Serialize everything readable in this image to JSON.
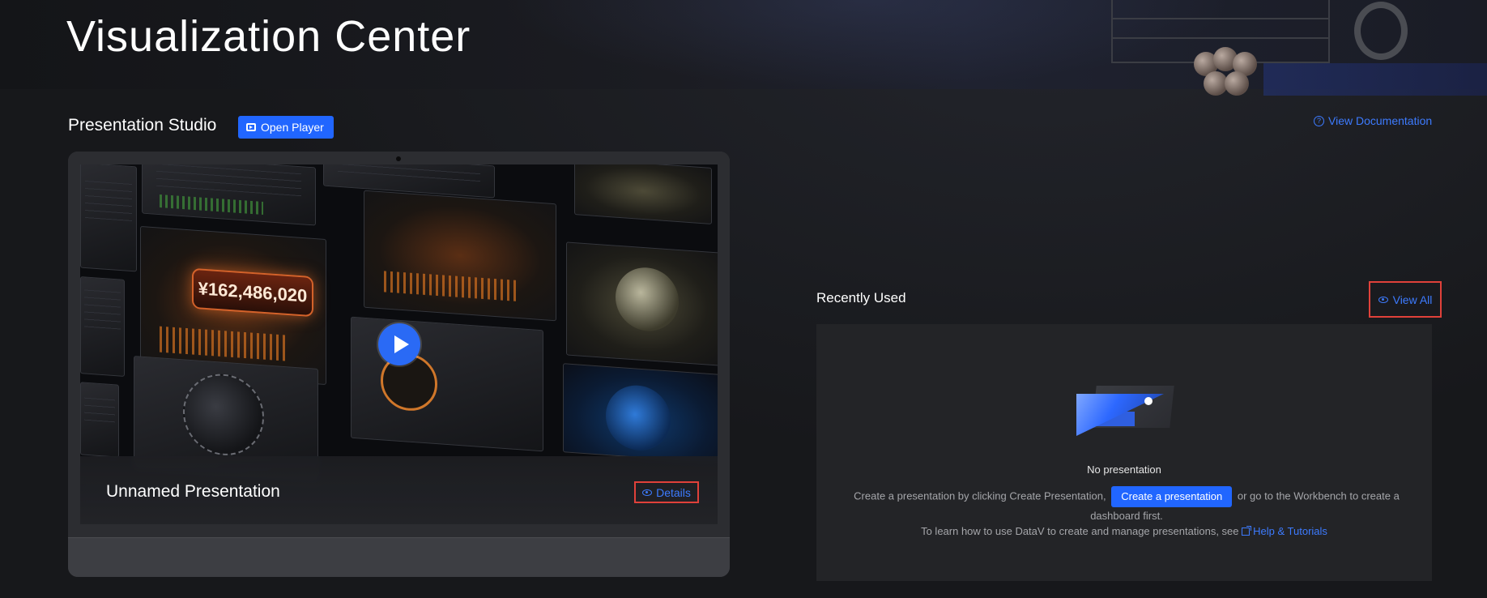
{
  "header": {
    "title": "Visualization Center"
  },
  "studio": {
    "title": "Presentation Studio",
    "open_player_label": "Open Player",
    "view_documentation_label": "View Documentation"
  },
  "preview": {
    "caption": "Unnamed Presentation",
    "details_label": "Details",
    "big_number": "¥162,486,020"
  },
  "recent": {
    "title": "Recently Used",
    "view_all_label": "View All",
    "empty_title": "No presentation",
    "help_prefix": "Create a presentation by clicking Create Presentation,",
    "create_button_label": "Create a presentation",
    "help_suffix": "or go to the Workbench to create a dashboard first.",
    "learn_text": "To learn how to use DataV to create and manage presentations, see",
    "help_link_label": "Help & Tutorials"
  },
  "colors": {
    "accent": "#2166ff",
    "link": "#3d7bff",
    "highlight_box": "#e0413a",
    "background": "#17181b"
  }
}
